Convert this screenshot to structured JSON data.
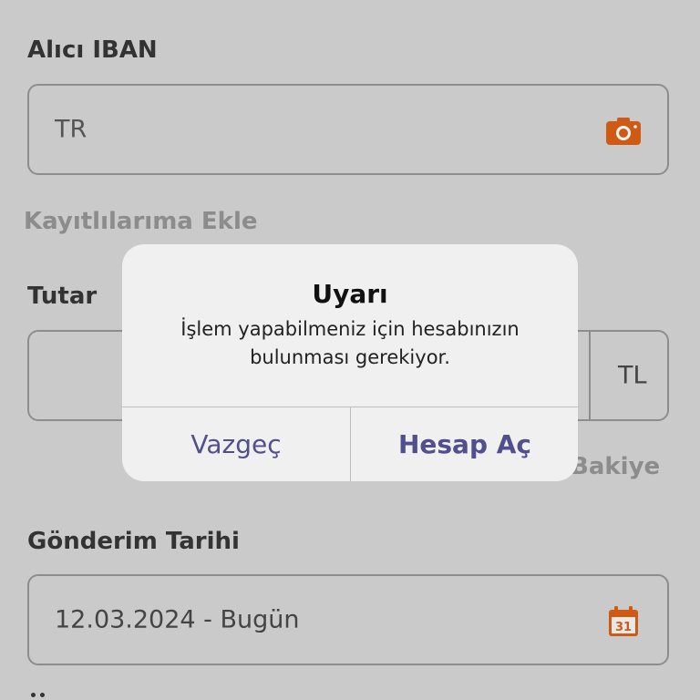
{
  "recipient": {
    "label": "Alıcı IBAN",
    "iban_value": "TR",
    "camera_icon": "camera-icon",
    "add_to_saved_link": "Kayıtlılarıma Ekle"
  },
  "amount": {
    "label": "Tutar",
    "currency": "TL",
    "balance_link": "Bakiye"
  },
  "send_date": {
    "label": "Gönderim Tarihi",
    "value": "12.03.2024 - Bugün",
    "calendar_icon": "calendar-icon",
    "calendar_day": "31"
  },
  "dialog": {
    "title": "Uyarı",
    "message": "İşlem yapabilmeniz için hesabınızın bulunması gerekiyor.",
    "cancel_label": "Vazgeç",
    "confirm_label": "Hesap Aç"
  },
  "colors": {
    "accent": "#cf5a14",
    "dialog_button": "#514f8c",
    "backdrop": "#cacaca"
  }
}
